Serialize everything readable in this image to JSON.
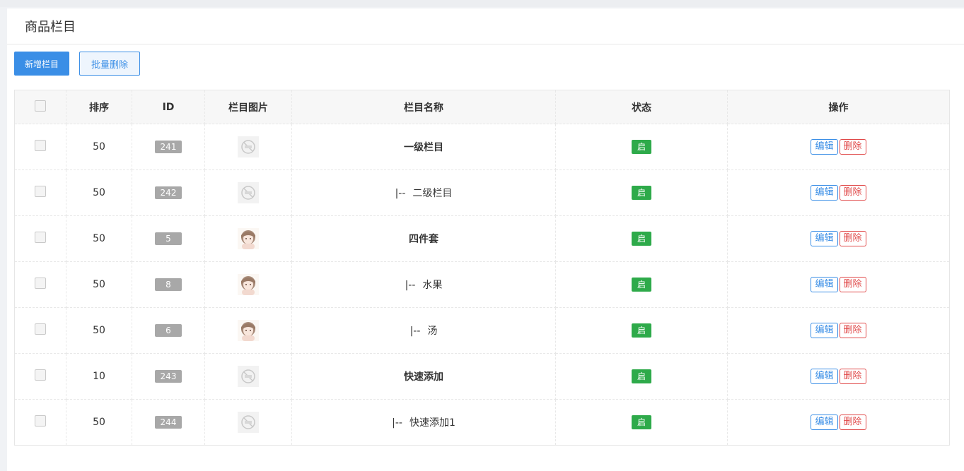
{
  "header": {
    "title": "商品栏目"
  },
  "toolbar": {
    "add_label": "新增栏目",
    "batch_delete_label": "批量删除"
  },
  "table": {
    "columns": [
      "排序",
      "ID",
      "栏目图片",
      "栏目名称",
      "状态",
      "操作"
    ],
    "rows": [
      {
        "sort": "50",
        "id": "241",
        "image": "no-image-placeholder",
        "prefix": "",
        "name": "一级栏目",
        "level": 1,
        "status": "启",
        "edit": "编辑",
        "delete": "删除"
      },
      {
        "sort": "50",
        "id": "242",
        "image": "no-image-placeholder",
        "prefix": "|--",
        "name": "二级栏目",
        "level": 2,
        "status": "启",
        "edit": "编辑",
        "delete": "删除"
      },
      {
        "sort": "50",
        "id": "5",
        "image": "anime-girl-avatar",
        "prefix": "",
        "name": "四件套",
        "level": 1,
        "status": "启",
        "edit": "编辑",
        "delete": "删除"
      },
      {
        "sort": "50",
        "id": "8",
        "image": "anime-girl-avatar",
        "prefix": "|--",
        "name": "水果",
        "level": 2,
        "status": "启",
        "edit": "编辑",
        "delete": "删除"
      },
      {
        "sort": "50",
        "id": "6",
        "image": "anime-girl-avatar",
        "prefix": "|--",
        "name": "汤",
        "level": 2,
        "status": "启",
        "edit": "编辑",
        "delete": "删除"
      },
      {
        "sort": "10",
        "id": "243",
        "image": "no-image-placeholder",
        "prefix": "",
        "name": "快速添加",
        "level": 1,
        "status": "启",
        "edit": "编辑",
        "delete": "删除"
      },
      {
        "sort": "50",
        "id": "244",
        "image": "no-image-placeholder",
        "prefix": "|--",
        "name": "快速添加1",
        "level": 2,
        "status": "启",
        "edit": "编辑",
        "delete": "删除"
      }
    ]
  },
  "colors": {
    "primary": "#3a8ee6",
    "status_on": "#2eaa4a",
    "danger": "#e04848",
    "id_badge": "#a8a8a8"
  }
}
